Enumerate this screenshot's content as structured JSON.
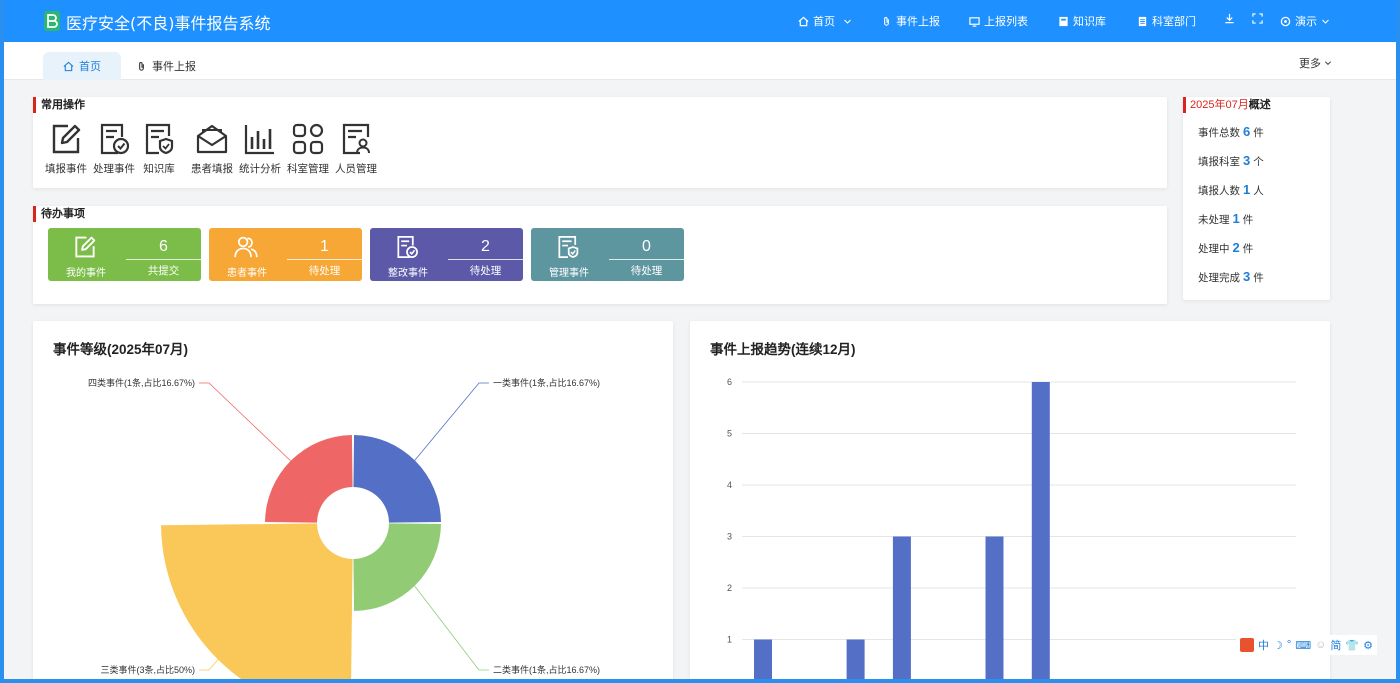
{
  "app": {
    "title": "医疗安全(不良)事件报告系统"
  },
  "nav": [
    {
      "label": "首页",
      "icon": "home-icon",
      "dropdown": true
    },
    {
      "label": "事件上报",
      "icon": "paperclip-icon"
    },
    {
      "label": "上报列表",
      "icon": "monitor-icon"
    },
    {
      "label": "知识库",
      "icon": "book-icon"
    },
    {
      "label": "科室部门",
      "icon": "document-icon"
    }
  ],
  "user": {
    "name": "演示"
  },
  "tabs": [
    {
      "label": "首页",
      "icon": "home-icon",
      "active": true
    },
    {
      "label": "事件上报",
      "icon": "paperclip-icon",
      "active": false
    }
  ],
  "more_label": "更多",
  "quick_actions": {
    "title": "常用操作",
    "items": [
      {
        "label": "填报事件",
        "icon": "edit-icon"
      },
      {
        "label": "处理事件",
        "icon": "doc-check-icon"
      },
      {
        "label": "知识库",
        "icon": "doc-shield-icon"
      },
      {
        "label": "患者填报",
        "icon": "mail-open-icon"
      },
      {
        "label": "统计分析",
        "icon": "bar-chart-icon"
      },
      {
        "label": "科室管理",
        "icon": "apps-icon"
      },
      {
        "label": "人员管理",
        "icon": "id-card-icon"
      }
    ]
  },
  "todos": {
    "title": "待办事项",
    "items": [
      {
        "name": "我的事件",
        "count": "6",
        "status": "共提交",
        "color": "#7cbc48",
        "icon": "edit-icon"
      },
      {
        "name": "患者事件",
        "count": "1",
        "status": "待处理",
        "color": "#f6a735",
        "icon": "users-icon"
      },
      {
        "name": "整改事件",
        "count": "2",
        "status": "待处理",
        "color": "#5b59a8",
        "icon": "doc-check-icon"
      },
      {
        "name": "管理事件",
        "count": "0",
        "status": "待处理",
        "color": "#5e96a0",
        "icon": "doc-shield-icon"
      }
    ]
  },
  "overview": {
    "date": "2025年07月",
    "label": "概述",
    "items": [
      {
        "label": "事件总数",
        "value": "6",
        "unit": "件"
      },
      {
        "label": "填报科室",
        "value": "3",
        "unit": "个"
      },
      {
        "label": "填报人数",
        "value": "1",
        "unit": "人"
      },
      {
        "label": "未处理",
        "value": "1",
        "unit": "件"
      },
      {
        "label": "处理中",
        "value": "2",
        "unit": "件"
      },
      {
        "label": "处理完成",
        "value": "3",
        "unit": "件"
      }
    ]
  },
  "pie_title": "事件等级(2025年07月)",
  "bar_title": "事件上报趋势(连续12月)",
  "chart_data": [
    {
      "type": "pie",
      "variant": "rose",
      "title": "事件等级(2025年07月)",
      "slices": [
        {
          "name": "一类事件",
          "value": 1,
          "label": "一类事件(1条,占比16.67%)",
          "color": "#5470c6"
        },
        {
          "name": "二类事件",
          "value": 1,
          "label": "二类事件(1条,占比16.67%)",
          "color": "#91cc75"
        },
        {
          "name": "三类事件",
          "value": 3,
          "label": "三类事件(3条,占比50%)",
          "color": "#fac858"
        },
        {
          "name": "四类事件",
          "value": 1,
          "label": "四类事件(1条,占比16.67%)",
          "color": "#ee6666"
        }
      ]
    },
    {
      "type": "bar",
      "title": "事件上报趋势(连续12月)",
      "values": [
        1,
        0,
        1,
        3,
        0,
        3,
        6
      ],
      "ylim": [
        0,
        6
      ],
      "yticks": [
        "1",
        "2",
        "3",
        "4",
        "5",
        "6"
      ],
      "color": "#5470c6",
      "grid": true
    }
  ],
  "ime": {
    "lang": "中",
    "simp": "简"
  }
}
